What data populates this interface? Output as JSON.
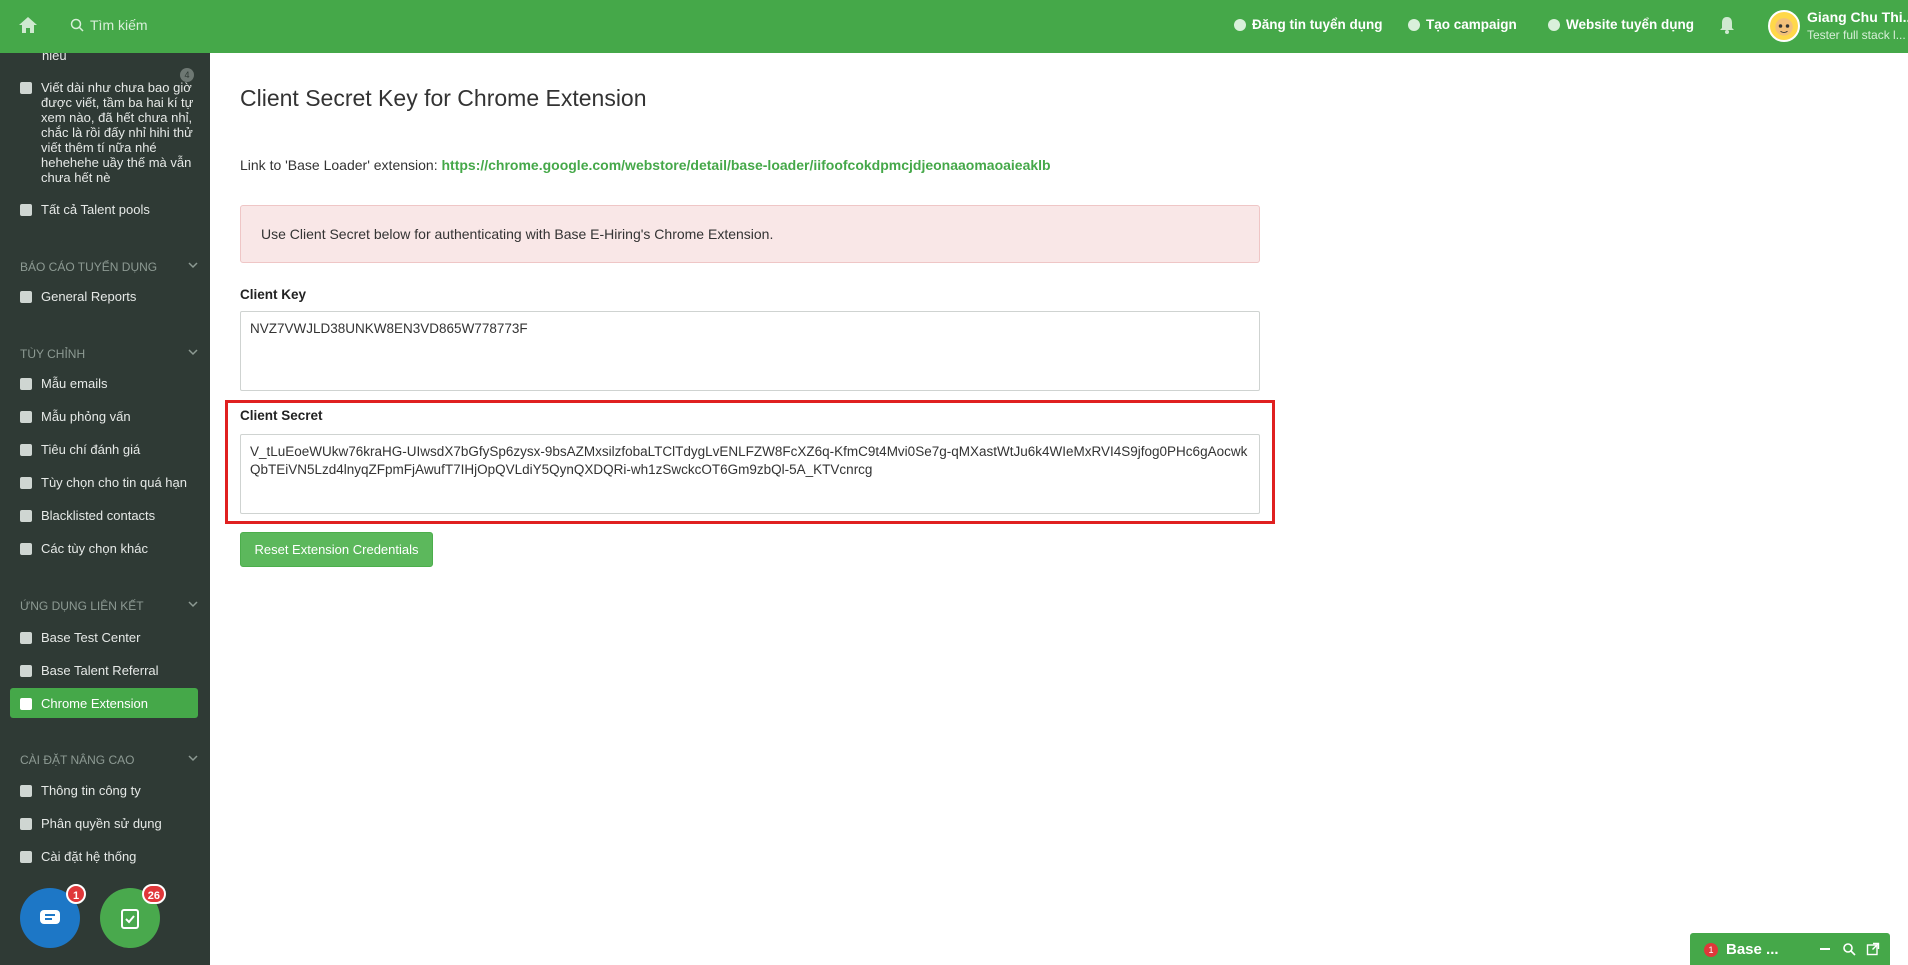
{
  "topbar": {
    "search_placeholder": "Tìm kiếm",
    "post_job": "Đăng tin tuyển dụng",
    "create_campaign": "Tạo campaign",
    "career_site": "Website tuyển dụng",
    "user_name": "Giang Chu Thi...",
    "user_role": "Tester full stack l..."
  },
  "sidebar": {
    "truncated_top": "hiểu",
    "long_item": "Viết dài như chưa bao giờ được viết, tầm ba hai kí tự xem nào, đã hết chưa nhỉ, chắc là rồi đấy nhỉ hihi thử viết thêm tí nữa nhé hehehehe uầy thế mà vẫn chưa hết nè",
    "long_item_badge": "4",
    "all_talent_pools": "Tất cả Talent pools",
    "section_reports": "BÁO CÁO TUYỂN DỤNG",
    "general_reports": "General Reports",
    "section_custom": "TÙY CHỈNH",
    "email_templates": "Mẫu emails",
    "interview_templates": "Mẫu phỏng vấn",
    "evaluation_criteria": "Tiêu chí đánh giá",
    "expired_options": "Tùy chọn cho tin quá hạn",
    "blacklisted": "Blacklisted contacts",
    "other_options": "Các tùy chọn khác",
    "section_apps": "ỨNG DỤNG LIÊN KẾT",
    "test_center": "Base Test Center",
    "talent_referral": "Base Talent Referral",
    "chrome_extension": "Chrome Extension",
    "section_advanced": "CÀI ĐẶT NÂNG CAO",
    "company_info": "Thông tin công ty",
    "permissions": "Phân quyền sử dụng",
    "system_settings": "Cài đặt hệ thống",
    "chat_badge": "1",
    "task_badge": "26"
  },
  "main": {
    "title": "Client Secret Key for Chrome Extension",
    "link_prefix": "Link to 'Base Loader' extension:",
    "link_url": "https://chrome.google.com/webstore/detail/base-loader/iifoofcokdpmcjdjeonaaomaoaieaklb",
    "alert": "Use Client Secret below for authenticating with Base E-Hiring's Chrome Extension.",
    "client_key_label": "Client Key",
    "client_key_value": "NVZ7VWJLD38UNKW8EN3VD865W778773F",
    "client_secret_label": "Client Secret",
    "client_secret_value": "V_tLuEoeWUkw76kraHG-UIwsdX7bGfySp6zysx-9bsAZMxsilzfobaLTClTdygLvENLFZW8FcXZ6q-KfmC9t4Mvi0Se7g-qMXastWtJu6k4WIeMxRVI4S9jfog0PHc6gAocwkQbTEiVN5Lzd4lnyqZFpmFjAwufT7IHjOpQVLdiY5QynQXDQRi-wh1zSwckcOT6Gm9zbQl-5A_KTVcnrcg",
    "reset_button": "Reset Extension Credentials"
  },
  "dock": {
    "badge": "1",
    "title": "Base ..."
  },
  "colors": {
    "brand_green": "#45a849",
    "sidebar_bg": "#2f3a35",
    "alert_bg": "#f9e7e7",
    "highlight_red": "#e02020"
  }
}
